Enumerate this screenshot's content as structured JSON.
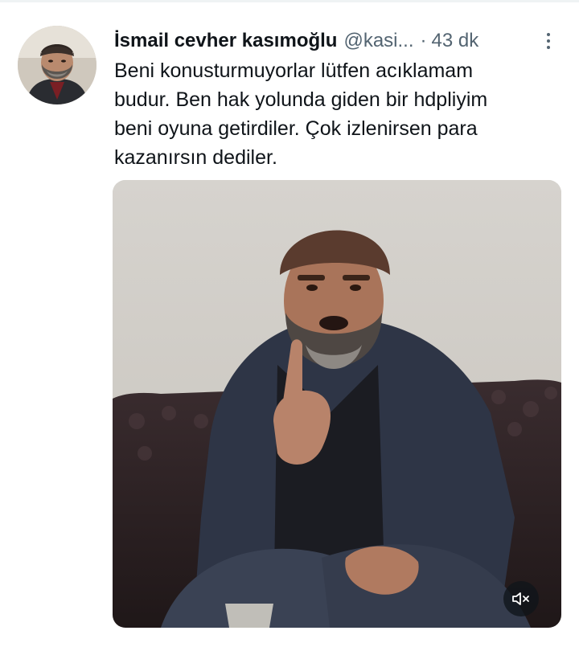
{
  "tweet": {
    "author_name": "İsmail cevher kasımoğlu",
    "handle": "@kasi...",
    "separator": "·",
    "time": "43 dk",
    "text_lines": [
      "Beni konusturmuyorlar lütfen acıklamam",
      "budur. Ben hak yolunda giden bir hdpliyim",
      "beni oyuna getirdiler. Çok izlenirsen para",
      "kazanırsın dediler."
    ]
  },
  "icons": {
    "more": "more-vertical-icon",
    "mute": "volume-muted-icon"
  },
  "colors": {
    "text_primary": "#0f1419",
    "text_secondary": "#536471",
    "background": "#ffffff"
  }
}
